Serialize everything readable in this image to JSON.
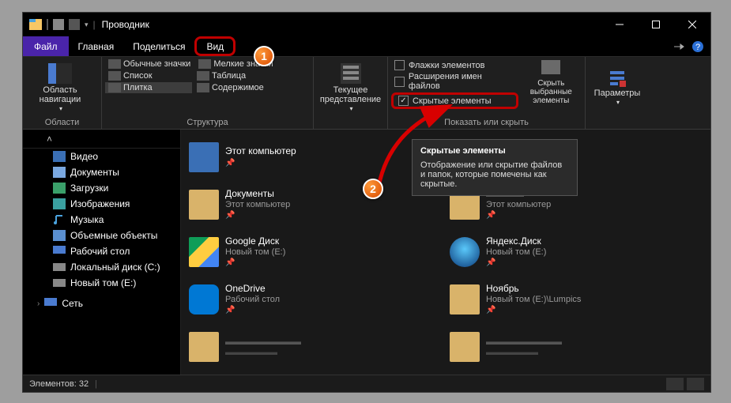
{
  "title": "Проводник",
  "menubar": {
    "file": "Файл",
    "home": "Главная",
    "share": "Поделиться",
    "view": "Вид"
  },
  "ribbon": {
    "nav_pane": "Область навигации",
    "nav_group_label": "Области",
    "layout": {
      "regular": "Обычные значки",
      "small": "Мелкие значки",
      "list": "Список",
      "table": "Таблица",
      "tiles": "Плитка",
      "content": "Содержимое",
      "group_label": "Структура"
    },
    "current_view": "Текущее представление",
    "show": {
      "item_checkboxes": "Флажки элементов",
      "file_ext": "Расширения имен файлов",
      "hidden_items": "Скрытые элементы",
      "group_label": "Показать или скрыть"
    },
    "hide_selected": "Скрыть выбранные элементы",
    "options": "Параметры"
  },
  "nav": {
    "video": "Видео",
    "documents": "Документы",
    "downloads": "Загрузки",
    "pictures": "Изображения",
    "music": "Музыка",
    "objects3d": "Объемные объекты",
    "desktop": "Рабочий стол",
    "localdisk": "Локальный диск (C:)",
    "newvol": "Новый том (E:)",
    "network": "Сеть"
  },
  "items": [
    {
      "name": "Этот компьютер",
      "sub": "",
      "icon": "pc"
    },
    {
      "name": "",
      "sub": "",
      "icon": "folder"
    },
    {
      "name": "Документы",
      "sub": "Этот компьютер",
      "icon": "folder"
    },
    {
      "name": "",
      "sub": "Этот компьютер",
      "icon": "folder"
    },
    {
      "name": "Google Диск",
      "sub": "Новый том (E:)",
      "icon": "gdrive"
    },
    {
      "name": "Яндекс.Диск",
      "sub": "Новый том (E:)",
      "icon": "yadisk"
    },
    {
      "name": "OneDrive",
      "sub": "Рабочий стол",
      "icon": "onedrive"
    },
    {
      "name": "Ноябрь",
      "sub": "Новый том (E:)\\Lumpics",
      "icon": "folder"
    }
  ],
  "tooltip": {
    "title": "Скрытые элементы",
    "body": "Отображение или скрытие файлов и папок, которые помечены как скрытые."
  },
  "status": {
    "count_label": "Элементов: 32"
  },
  "markers": {
    "one": "1",
    "two": "2"
  }
}
